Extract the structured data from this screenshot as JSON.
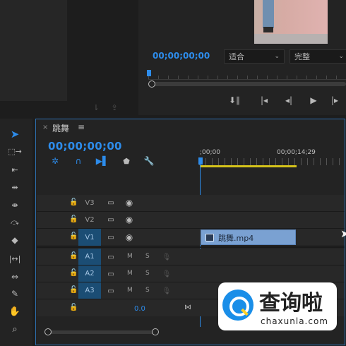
{
  "program_monitor": {
    "timecode": "00;00;00;00",
    "fit_select": "适合",
    "quality_select": "完整"
  },
  "timeline": {
    "tab_title": "跳舞",
    "timecode": "00;00;00;00",
    "ruler": {
      "start": ";00;00",
      "mark": "00;00;14;29"
    },
    "tracks": [
      {
        "name": "V3",
        "kind": "video",
        "targeted": false
      },
      {
        "name": "V2",
        "kind": "video",
        "targeted": false
      },
      {
        "name": "V1",
        "kind": "video",
        "targeted": true
      },
      {
        "name": "A1",
        "kind": "audio",
        "targeted": true,
        "m": "M",
        "s": "S"
      },
      {
        "name": "A2",
        "kind": "audio",
        "targeted": true,
        "m": "M",
        "s": "S"
      },
      {
        "name": "A3",
        "kind": "audio",
        "targeted": true,
        "m": "M",
        "s": "S"
      }
    ],
    "master_volume": "0.0",
    "clip": {
      "name": "跳舞.mp4"
    }
  },
  "watermark": {
    "brand": "查询啦",
    "domain": "chaxunla.com"
  }
}
